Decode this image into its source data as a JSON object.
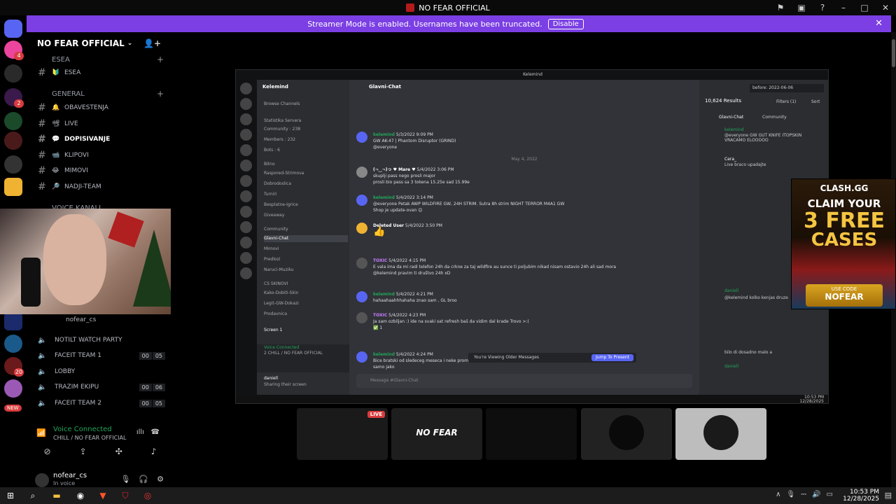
{
  "window": {
    "title": "NO FEAR OFFICIAL"
  },
  "banner": {
    "text": "Streamer Mode is enabled. Usernames have been truncated.",
    "button": "Disable"
  },
  "rail": {
    "badges": [
      "4",
      "2",
      "20"
    ],
    "new_label": "NEW"
  },
  "server": {
    "name": "NO FEAR OFFICIAL",
    "categories": [
      {
        "label": "ESEA"
      },
      {
        "label": "GENERAL"
      },
      {
        "label": "VOICE KANALI"
      }
    ],
    "channels": [
      {
        "label": "ESEA",
        "emoji": "🔰"
      },
      {
        "label": "OBAVESTENJA",
        "emoji": "🔔"
      },
      {
        "label": "LIVE",
        "emoji": "📽"
      },
      {
        "label": "DOPISIVANJE",
        "emoji": "💬"
      },
      {
        "label": "KLIPOVI",
        "emoji": "📹"
      },
      {
        "label": "MIMOVI",
        "emoji": "😂"
      },
      {
        "label": "NADJI-TEAM",
        "emoji": "🔎"
      }
    ],
    "voice_user": "nofear_cs",
    "voice_channels": [
      {
        "label": "NOTILT WATCH PARTY",
        "count": ""
      },
      {
        "label": "FACEIT TEAM 1",
        "count": [
          "00",
          "05"
        ]
      },
      {
        "label": "LOBBY",
        "count": ""
      },
      {
        "label": "TRAZIM EKIPU",
        "count": [
          "00",
          "06"
        ]
      },
      {
        "label": "FACEIT TEAM 2",
        "count": [
          "00",
          "05"
        ]
      }
    ]
  },
  "voice": {
    "status": "Voice Connected",
    "sub": "CHILL / NO FEAR OFFICIAL"
  },
  "user": {
    "name": "nofear_cs",
    "status": "In voice"
  },
  "shared": {
    "window_title": "Kelemind",
    "server": "Kelemind",
    "browse": "Browse Channels",
    "section_stats": "Statistika Servera",
    "stats": [
      "Community : 238",
      "Members : 232",
      "Bots : 6"
    ],
    "section_info": "Bitno",
    "info_channels": [
      "Raspored-Strimova",
      "Dobrodoslica",
      "Turniri",
      "Besplatne-Igrice",
      "Giveaway"
    ],
    "section_comm": "Community",
    "comm_channels": [
      "Glavni-Chat",
      "Mimovi",
      "Predlozi",
      "Naruci-Muziku"
    ],
    "section_cs": "CS SKINOVI",
    "cs_channels": [
      "Kako-Dobiti-Skin",
      "Legit-GW-Dokazi",
      "Prodavnica"
    ],
    "screen_label": "Screen 1",
    "vc_status": "Voice Connected",
    "vc_sub": "2 CHILL / NO FEAR OFFICIAL",
    "vc_user": "daniell",
    "vc_user_status": "Sharing their screen",
    "chat_title": "Glavni-Chat",
    "messages": [
      {
        "name": "kelemind",
        "time": "5/3/2022 9:09 PM",
        "text": "GW AK-47 | Phantom Disruptor (GRIND)",
        "extra": "@everyone"
      },
      {
        "name": "",
        "time": "",
        "text": "May 4, 2022",
        "extra": ""
      },
      {
        "name": "(¬‿¬)っ ♥ Mare ♥",
        "time": "5/4/2022 3:06 PM",
        "text": "skuplji pass nego prosli major",
        "extra": "prosli bio pass sa 3 tokena 15.25e sad 15.99e"
      },
      {
        "name": "kelemind",
        "time": "5/4/2022 3:14 PM",
        "text": "@everyone Petak AWP WILDFIRE GW, 24H STRIM. Sutra 8h strim NIGHT TERROR M4A1 GW",
        "extra": "Shop je update-ovan 😊"
      },
      {
        "name": "Deleted User",
        "time": "5/4/2022 3:50 PM",
        "text": "👍",
        "extra": ""
      },
      {
        "name": "TOXIC",
        "time": "5/4/2022 4:15 PM",
        "text": "E vala ima da mi radi telefon 24h da crkne za taj wildfire au sunce ti poljubim nikad nisam ostavio 24h ali sad mora",
        "extra": "@kelemind pravim ti društvo 24h xD"
      },
      {
        "name": "kelemind",
        "time": "5/4/2022 4:21 PM",
        "text": "hahaahaahhhahaha znao  sam , GL broo",
        "extra": ""
      },
      {
        "name": "TOXIC",
        "time": "5/4/2022 4:23 PM",
        "text": "Ja sam ozbiljan :) ide na svaki sat refresh baš da vidim dal krade Trovo >:(",
        "extra": "✅ 1"
      },
      {
        "name": "kelemind",
        "time": "5/4/2022 4:24 PM",
        "text": "Bice bratski od sledeceg meseca i neke promene",
        "extra": "samo jako"
      }
    ],
    "older_text": "You're Viewing Older Messages",
    "jump": "Jump To Present",
    "input_ph": "Message #Glavni-Chat",
    "search_query": "before: 2022-06-06",
    "results": "10,624 Results",
    "filters": "Filters (1)",
    "sort": "Sort",
    "results_channel": "Glavni-Chat",
    "results_tag": "Community",
    "res_msgs": [
      {
        "name": "kelemind",
        "text": "@everyone GW GUT KNIFE ITOPSKIN VRACAMO ELOOOOO"
      },
      {
        "name": "Cera_",
        "text": "Live braco upadajte"
      },
      {
        "name": "daniell",
        "text": "@kelemind kolko kenjas druze"
      },
      {
        "name": "daniell",
        "text": "bilo di dosadno malo a"
      }
    ],
    "tray_time": "10:53 PM",
    "tray_date": "12/28/2025"
  },
  "ad": {
    "brand": "CLASH.GG",
    "line1": "CLAIM YOUR",
    "line2": "3 FREE",
    "line3": "CASES",
    "code_label": "USE CODE",
    "code": "NOFEAR"
  },
  "tiles": {
    "live": "LIVE",
    "logo": "NO FEAR"
  },
  "taskbar": {
    "time": "10:53 PM",
    "date": "12/28/2025"
  }
}
